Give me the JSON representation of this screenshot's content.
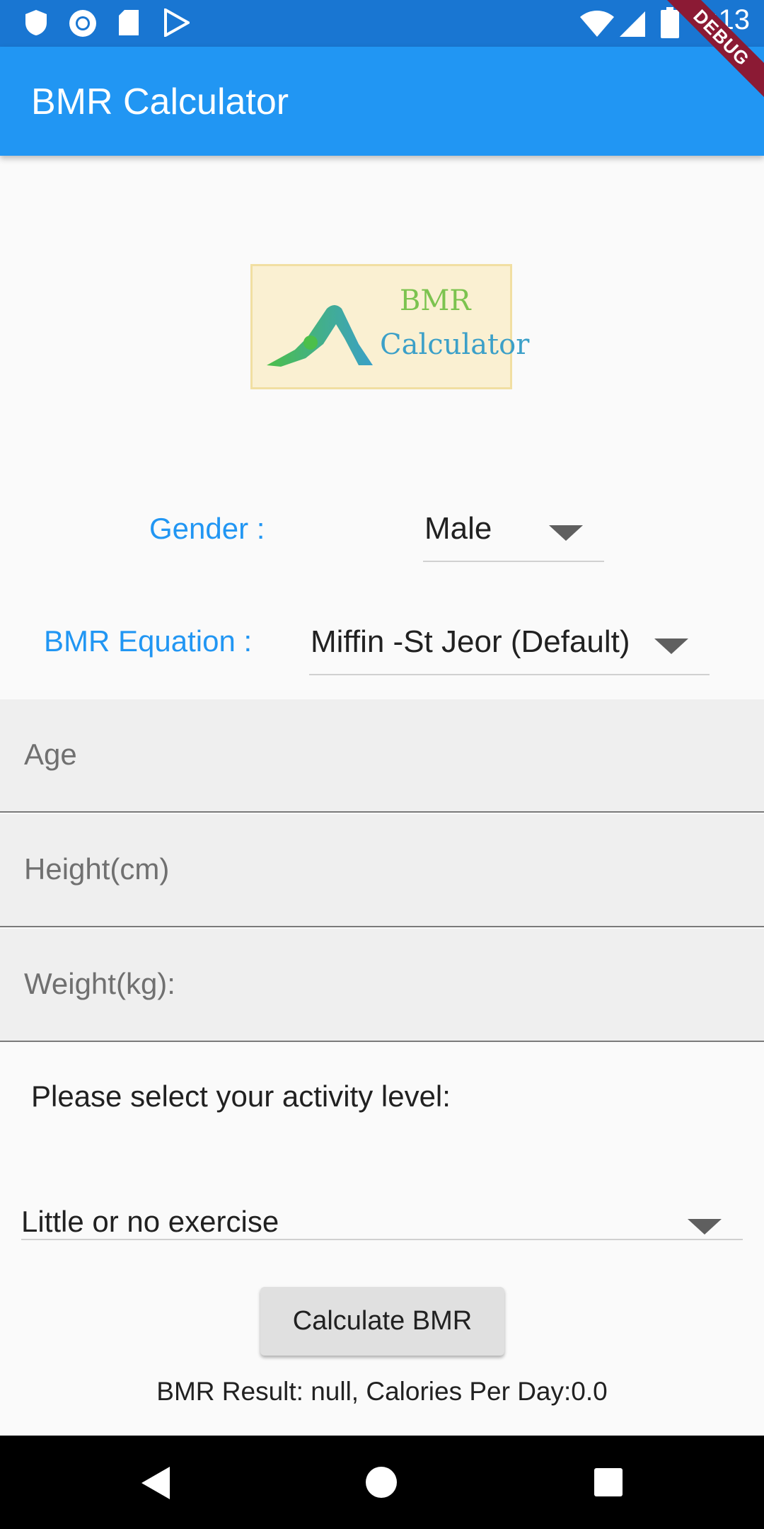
{
  "status_bar": {
    "time": "2:13",
    "icons": [
      "shield-icon",
      "circle-icon",
      "sd-card-icon",
      "play-store-icon",
      "wifi-icon",
      "signal-icon",
      "battery-icon"
    ]
  },
  "app_bar": {
    "title": "BMR Calculator",
    "debug_banner": "DEBUG"
  },
  "logo": {
    "line1": "BMR",
    "line2": "Calculator"
  },
  "gender": {
    "label": "Gender :",
    "value": "Male"
  },
  "equation": {
    "label": "BMR Equation :",
    "value": "Miffin -St Jeor (Default)"
  },
  "fields": {
    "age": "Age",
    "height": "Height(cm)",
    "weight": "Weight(kg):"
  },
  "activity": {
    "label": "Please select your activity level:",
    "value": "Little or no exercise"
  },
  "calculate_button": "Calculate BMR",
  "result": "BMR Result: null, Calories Per Day:0.0",
  "colors": {
    "primary": "#2196f3",
    "status": "#1976d2",
    "debug": "#8b1a34"
  }
}
